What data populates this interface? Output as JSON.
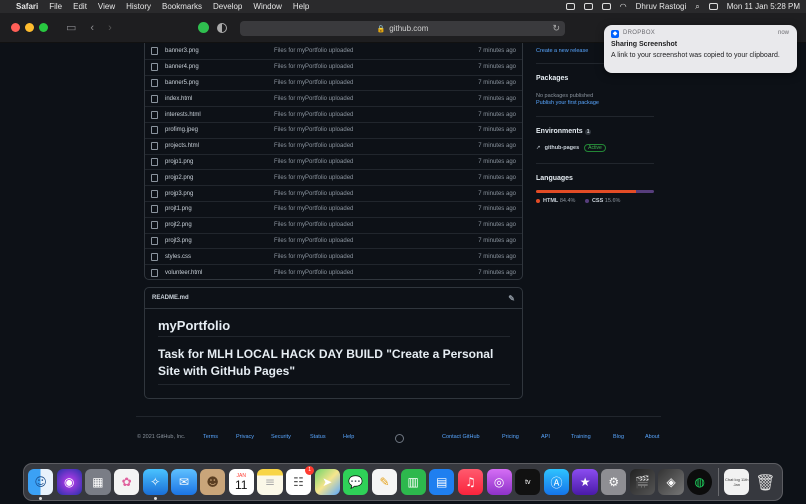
{
  "menubar": {
    "app": "Safari",
    "menus": [
      "File",
      "Edit",
      "View",
      "History",
      "Bookmarks",
      "Develop",
      "Window",
      "Help"
    ],
    "user": "Dhruv Rastogi",
    "datetime": "Mon 11 Jan  5:28 PM"
  },
  "browser": {
    "url": "github.com"
  },
  "files": [
    {
      "name": "banner3.png",
      "message": "Files for myPortfolio uploaded",
      "time": "7 minutes ago"
    },
    {
      "name": "banner4.png",
      "message": "Files for myPortfolio uploaded",
      "time": "7 minutes ago"
    },
    {
      "name": "banner5.png",
      "message": "Files for myPortfolio uploaded",
      "time": "7 minutes ago"
    },
    {
      "name": "index.html",
      "message": "Files for myPortfolio uploaded",
      "time": "7 minutes ago"
    },
    {
      "name": "interests.html",
      "message": "Files for myPortfolio uploaded",
      "time": "7 minutes ago"
    },
    {
      "name": "profimg.jpeg",
      "message": "Files for myPortfolio uploaded",
      "time": "7 minutes ago"
    },
    {
      "name": "projects.html",
      "message": "Files for myPortfolio uploaded",
      "time": "7 minutes ago"
    },
    {
      "name": "projp1.png",
      "message": "Files for myPortfolio uploaded",
      "time": "7 minutes ago"
    },
    {
      "name": "projp2.png",
      "message": "Files for myPortfolio uploaded",
      "time": "7 minutes ago"
    },
    {
      "name": "projp3.png",
      "message": "Files for myPortfolio uploaded",
      "time": "7 minutes ago"
    },
    {
      "name": "projt1.png",
      "message": "Files for myPortfolio uploaded",
      "time": "7 minutes ago"
    },
    {
      "name": "projt2.png",
      "message": "Files for myPortfolio uploaded",
      "time": "7 minutes ago"
    },
    {
      "name": "projt3.png",
      "message": "Files for myPortfolio uploaded",
      "time": "7 minutes ago"
    },
    {
      "name": "styles.css",
      "message": "Files for myPortfolio uploaded",
      "time": "7 minutes ago"
    },
    {
      "name": "volunteer.html",
      "message": "Files for myPortfolio uploaded",
      "time": "7 minutes ago"
    }
  ],
  "readme": {
    "filename": "README.md",
    "h1": "myPortfolio",
    "h2": "Task for MLH LOCAL HACK DAY BUILD \"Create a Personal Site with GitHub Pages\""
  },
  "sidebar": {
    "create_release": "Create a new release",
    "packages_title": "Packages",
    "packages_none": "No packages published",
    "publish_package": "Publish your first package",
    "environments_title": "Environments",
    "environments_count": "1",
    "env_name": "github-pages",
    "env_status": "Active",
    "languages_title": "Languages",
    "languages": [
      {
        "name": "HTML",
        "percent": "84.4%",
        "value": 84.4,
        "color": "#e34c26"
      },
      {
        "name": "CSS",
        "percent": "15.6%",
        "value": 15.6,
        "color": "#563d7c"
      }
    ]
  },
  "footer": {
    "copyright": "© 2021 GitHub, Inc.",
    "links_left": [
      "Terms",
      "Privacy",
      "Security",
      "Status",
      "Help"
    ],
    "links_right": [
      "Contact GitHub",
      "Pricing",
      "API",
      "Training",
      "Blog",
      "About"
    ]
  },
  "notification": {
    "app": "DROPBOX",
    "time": "now",
    "title": "Sharing Screenshot",
    "body": "A link to your screenshot was copied to your clipboard."
  },
  "dock": {
    "calendar_month": "JAN",
    "calendar_day": "11",
    "reminders_badge": "1",
    "file_label": "Chat log 11th Jan"
  }
}
